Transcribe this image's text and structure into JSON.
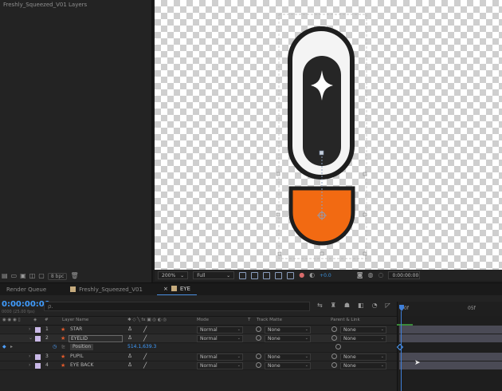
{
  "project_panel": {
    "title": "Freshly_Squeezed_V01 Layers",
    "bpc": "8 bpc"
  },
  "viewer_bar": {
    "zoom": "200%",
    "resolution": "Full",
    "exposure": "+0.0",
    "time": "0:00:00:00"
  },
  "tabs": [
    {
      "label": "Render Queue"
    },
    {
      "label": "Freshly_Squeezed_V01"
    },
    {
      "label": "EYE"
    }
  ],
  "timeline": {
    "timecode": "0:00:00:00",
    "fps": "0000 (25.00 fps)",
    "search_placeholder": "ρ.",
    "columns": {
      "num": "#",
      "layer_name": "Layer Name",
      "mode": "Mode",
      "t": "T",
      "track_matte": "Track Matte",
      "parent": "Parent & Link"
    },
    "ruler": {
      "start": "0f",
      "mark": "05f"
    },
    "layers": [
      {
        "num": "1",
        "name": "STAR",
        "mode": "Normal",
        "matte": "None",
        "parent": "None"
      },
      {
        "num": "2",
        "name": "EYELID",
        "mode": "Normal",
        "matte": "None",
        "parent": "None"
      },
      {
        "num": "3",
        "name": "PUPIL",
        "mode": "Normal",
        "matte": "None",
        "parent": "None"
      },
      {
        "num": "4",
        "name": "EYE BACK",
        "mode": "Normal",
        "matte": "None",
        "parent": "None"
      }
    ],
    "property": {
      "name": "Position",
      "value": "514.1,639.3"
    }
  },
  "colors": {
    "accent": "#3f9cff",
    "orange": "#f26a12",
    "layer_label": "#c9b8e6"
  }
}
